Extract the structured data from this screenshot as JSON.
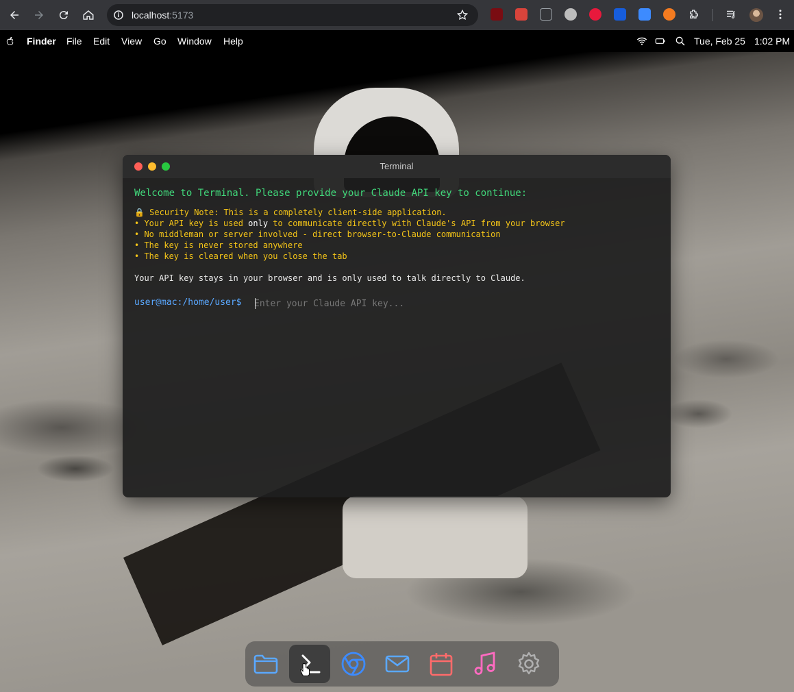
{
  "browser": {
    "url_host": "localhost",
    "url_port": ":5173",
    "back_icon": "arrow-left-icon",
    "forward_icon": "arrow-right-icon",
    "reload_icon": "reload-icon",
    "home_icon": "home-icon",
    "extensions": [
      {
        "name": "ublock-extension-icon",
        "color": "#c4121b"
      },
      {
        "name": "extension-red-icon",
        "color": "#d9443b"
      },
      {
        "name": "extension-bracket-icon",
        "color": "#9aa0a6"
      },
      {
        "name": "extension-gray-icon",
        "color": "#bdbdbd"
      },
      {
        "name": "extension-music-icon",
        "color": "#e8193c"
      },
      {
        "name": "bitwarden-extension-icon",
        "color": "#175ddc"
      },
      {
        "name": "extension-puzzle-blue-icon",
        "color": "#3d8bff"
      },
      {
        "name": "extension-orange-icon",
        "color": "#f47b20"
      },
      {
        "name": "extensions-puzzle-icon",
        "color": "#e8eaed"
      }
    ]
  },
  "menubar": {
    "app": "Finder",
    "items": [
      "File",
      "Edit",
      "View",
      "Go",
      "Window",
      "Help"
    ],
    "date": "Tue, Feb 25",
    "time": "1:02 PM"
  },
  "terminal": {
    "title": "Terminal",
    "welcome": "Welcome to Terminal. Please provide your Claude API key to continue:",
    "security_lock": "🔒",
    "security_note": " Security Note: This is a completely client-side application.",
    "bullet1_a": "• Your API key is used ",
    "bullet1_b": "only",
    "bullet1_c": " to communicate directly with Claude's API from your browser",
    "bullet2": "• No middleman or server involved - direct browser-to-Claude communication",
    "bullet3": "• The key is never stored anywhere",
    "bullet4": "• The key is cleared when you close the tab",
    "stays": "Your API key stays in your browser and is only used to talk directly to Claude.",
    "prompt": "user@mac:/home/user$",
    "input_placeholder": "Enter your Claude API key...",
    "input_value": ""
  },
  "dock": {
    "items": [
      "folder-icon",
      "terminal-icon",
      "chrome-icon",
      "mail-icon",
      "calendar-icon",
      "music-icon",
      "settings-icon"
    ],
    "active": "terminal-icon"
  },
  "colors": {
    "prompt": "#5aa8ff",
    "welcome": "#41d87b",
    "note": "#f5c518"
  }
}
